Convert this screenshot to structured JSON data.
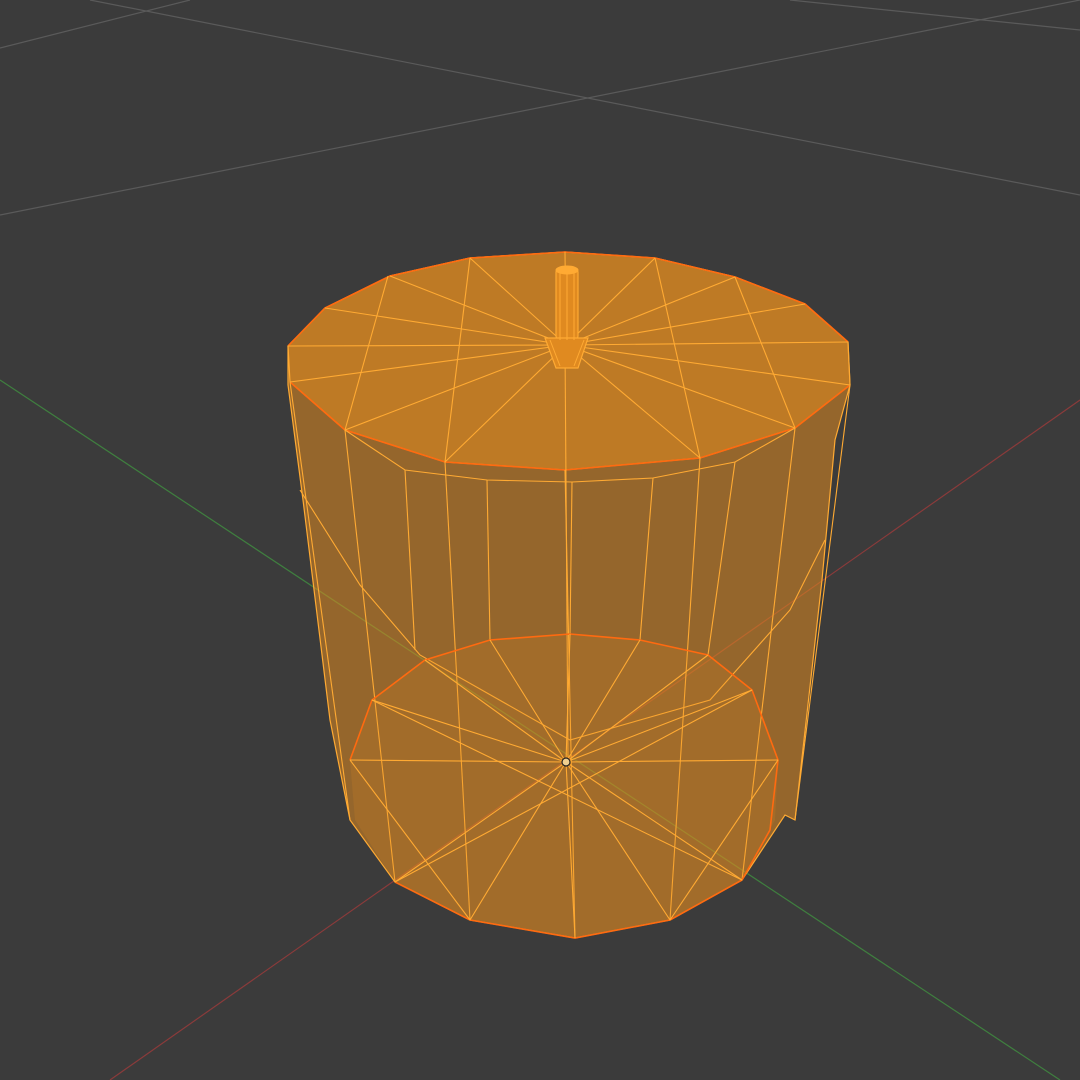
{
  "viewport": {
    "background_color": "#3b3b3b",
    "grid_color": "#5a5a5a",
    "x_axis_color": "#8a3b3b",
    "y_axis_color": "#3f7f3f"
  },
  "object": {
    "type": "cylinder-with-knob",
    "selected": true,
    "face_color": "#e08a20",
    "wire_color": "#ffaa33",
    "active_edge_color": "#ff6a10",
    "origin_color": "#f0d090",
    "origin_icon": "origin-dot-icon"
  }
}
